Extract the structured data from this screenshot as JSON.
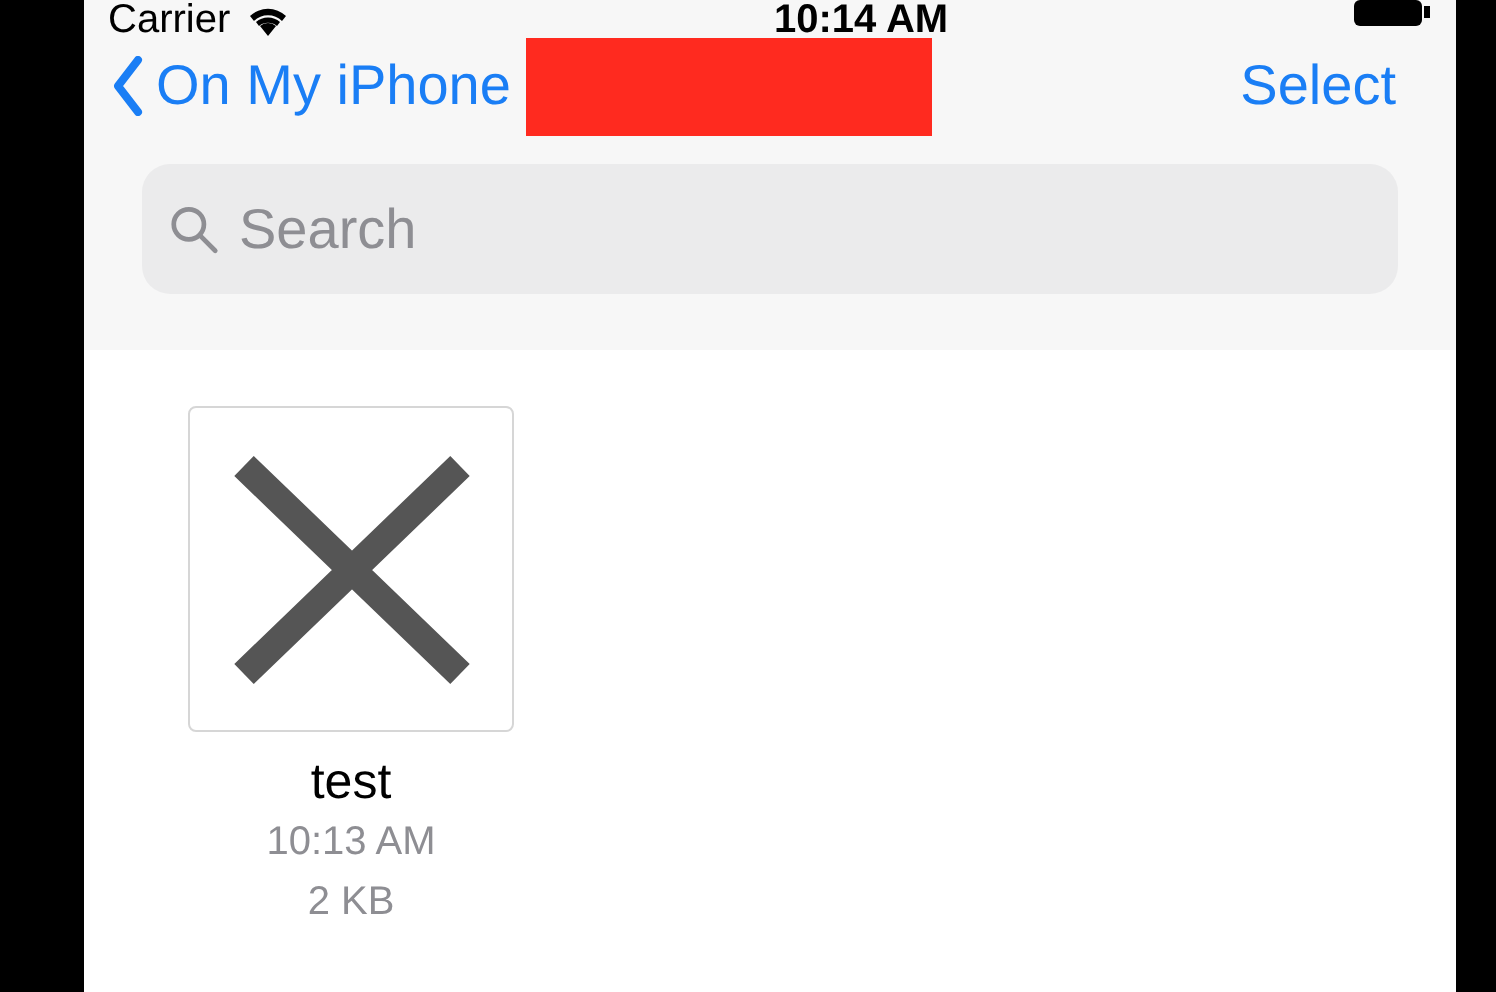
{
  "status_bar": {
    "carrier": "Carrier",
    "time": "10:14 AM"
  },
  "nav": {
    "back_label": "On My iPhone",
    "action": "Select"
  },
  "search": {
    "placeholder": "Search"
  },
  "files": [
    {
      "name": "test",
      "modified": "10:13 AM",
      "size": "2 KB"
    }
  ]
}
